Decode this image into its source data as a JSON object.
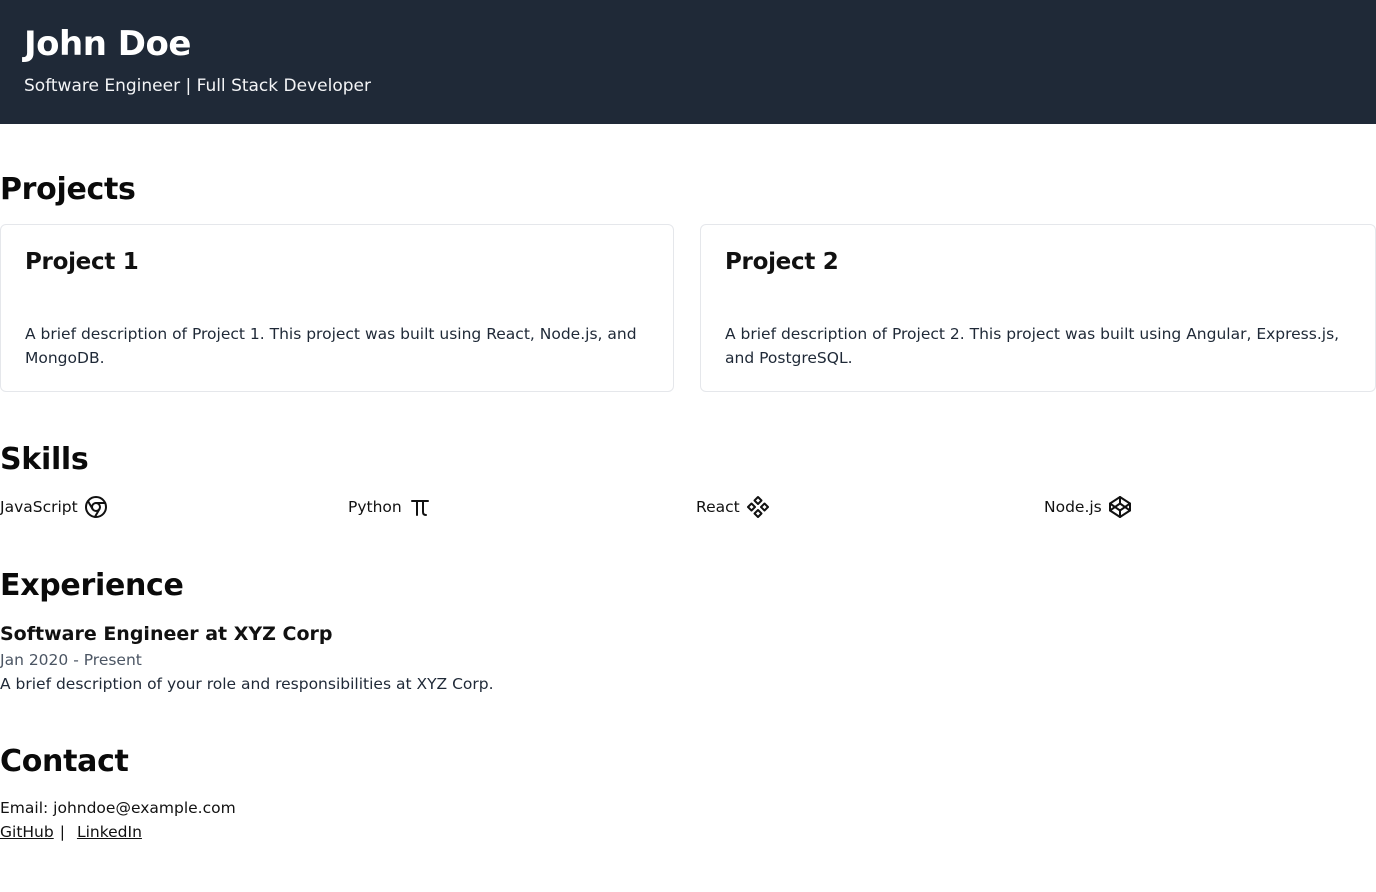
{
  "header": {
    "name": "John Doe",
    "tagline": "Software Engineer | Full Stack Developer"
  },
  "projects": {
    "title": "Projects",
    "items": [
      {
        "title": "Project 1",
        "description": "A brief description of Project 1. This project was built using React, Node.js, and MongoDB."
      },
      {
        "title": "Project 2",
        "description": "A brief description of Project 2. This project was built using Angular, Express.js, and PostgreSQL."
      }
    ]
  },
  "skills": {
    "title": "Skills",
    "items": [
      {
        "label": "JavaScript",
        "icon": "chrome-icon"
      },
      {
        "label": "Python",
        "icon": "pi-icon"
      },
      {
        "label": "React",
        "icon": "components-icon"
      },
      {
        "label": "Node.js",
        "icon": "codepen-icon"
      }
    ]
  },
  "experience": {
    "title": "Experience",
    "role": "Software Engineer at XYZ Corp",
    "dates": "Jan 2020 - Present",
    "description": "A brief description of your role and responsibilities at XYZ Corp."
  },
  "contact": {
    "title": "Contact",
    "email": "Email: johndoe@example.com",
    "separator": "|",
    "links": [
      {
        "label": "GitHub"
      },
      {
        "label": "LinkedIn"
      }
    ]
  },
  "colors": {
    "header_bg": "#1f2937",
    "header_text": "#ffffff",
    "muted_text": "#4b5563",
    "card_border": "#e5e7eb"
  }
}
